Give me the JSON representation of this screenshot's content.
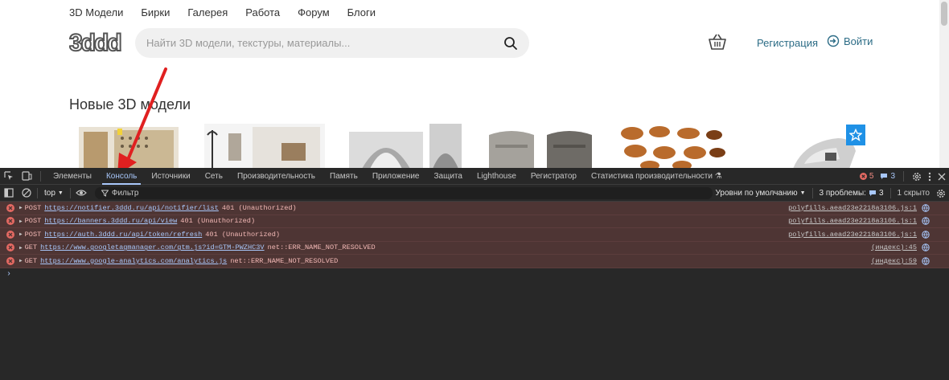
{
  "site": {
    "nav": [
      "3D Модели",
      "Бирки",
      "Галерея",
      "Работа",
      "Форум",
      "Блоги"
    ],
    "logo_text": "3ddd",
    "search_placeholder": "Найти 3D модели, текстуры, материалы...",
    "register_label": "Регистрация",
    "login_label": "Войти",
    "section_title": "Новые 3D модели",
    "colors": {
      "link": "#2c6c86",
      "badge": "#1f91e6",
      "arrow": "#e02020"
    }
  },
  "devtools": {
    "tabs": [
      "Элементы",
      "Консоль",
      "Источники",
      "Сеть",
      "Производительность",
      "Память",
      "Приложение",
      "Защита",
      "Lighthouse",
      "Регистратор",
      "Статистика производительности"
    ],
    "active_tab": "Консоль",
    "error_count": "5",
    "info_count": "3",
    "toolbar": {
      "context": "top",
      "filter_placeholder": "Фильтр",
      "levels": "Уровни по умолчанию",
      "issues_label": "3 проблемы:",
      "issues_count": "3",
      "hidden": "1 скрыто"
    },
    "logs": [
      {
        "method": "POST",
        "url": "https://notifier.3ddd.ru/api/notifier/list",
        "message": "401 (Unauthorized)",
        "source": "polyfills.aead23e2218a3106.js:1"
      },
      {
        "method": "POST",
        "url": "https://banners.3ddd.ru/api/view",
        "message": "401 (Unauthorized)",
        "source": "polyfills.aead23e2218a3106.js:1"
      },
      {
        "method": "POST",
        "url": "https://auth.3ddd.ru/api/token/refresh",
        "message": "401 (Unauthorized)",
        "source": "polyfills.aead23e2218a3106.js:1"
      },
      {
        "method": "GET",
        "url": "https://www.googletagmanager.com/gtm.js?id=GTM-PWZHC3V",
        "message": "net::ERR_NAME_NOT_RESOLVED",
        "source": "(индекс):45"
      },
      {
        "method": "GET",
        "url": "https://www.google-analytics.com/analytics.js",
        "message": "net::ERR_NAME_NOT_RESOLVED",
        "source": "(индекс):59"
      }
    ],
    "prompt": "›"
  }
}
